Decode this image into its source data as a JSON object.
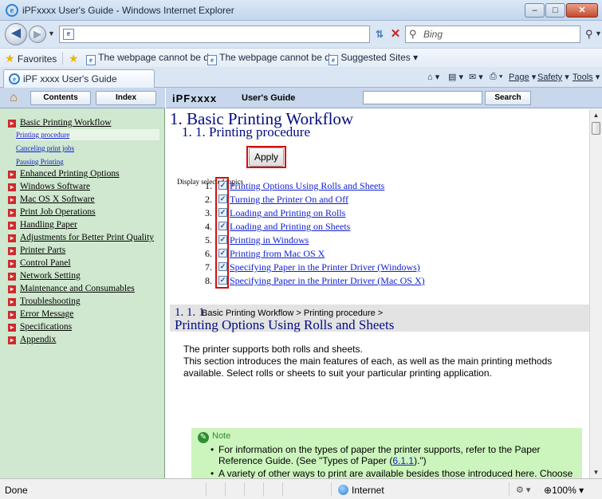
{
  "window": {
    "title": "iPFxxxx User's Guide - Windows Internet Explorer",
    "minimize": "–",
    "maximize": "□",
    "close": "✕"
  },
  "address": {
    "url": "",
    "search_placeholder": "Bing"
  },
  "favorites_bar": {
    "favorites_label": "Favorites",
    "links": [
      "The webpage cannot be d...",
      "The webpage cannot be d...",
      "Suggested Sites ▾"
    ]
  },
  "tab": {
    "title": "iPF xxxx User's Guide"
  },
  "command_bar": {
    "page": "Page",
    "safety": "Safety",
    "tools": "Tools"
  },
  "left_pane": {
    "tabs": {
      "contents": "Contents",
      "index": "Index"
    },
    "tree": [
      {
        "label": "Basic Printing Workflow",
        "children": [
          "Printing procedure",
          "Canceling print jobs",
          "Pausing Printing"
        ]
      },
      {
        "label": "Enhanced Printing Options"
      },
      {
        "label": "Windows Software"
      },
      {
        "label": "Mac OS X Software"
      },
      {
        "label": "Print Job Operations"
      },
      {
        "label": "Handling Paper"
      },
      {
        "label": "Adjustments for Better Print Quality"
      },
      {
        "label": "Printer Parts"
      },
      {
        "label": "Control Panel"
      },
      {
        "label": "Network Setting"
      },
      {
        "label": "Maintenance and Consumables"
      },
      {
        "label": "Troubleshooting"
      },
      {
        "label": "Error Message"
      },
      {
        "label": "Specifications"
      },
      {
        "label": "Appendix"
      }
    ]
  },
  "header": {
    "brand": "iPFxxxx",
    "title": "User's Guide",
    "search_button": "Search"
  },
  "main": {
    "h1": "1. Basic Printing Workflow",
    "h2": "1. 1. Printing procedure",
    "display_label": "Display selected topics",
    "apply_label": "Apply",
    "topics": [
      {
        "num": "1.",
        "label": "Printing Options Using Rolls and Sheets"
      },
      {
        "num": "2.",
        "label": "Turning the Printer On and Off"
      },
      {
        "num": "3.",
        "label": "Loading and Printing on Rolls"
      },
      {
        "num": "4.",
        "label": "Loading and Printing on Sheets"
      },
      {
        "num": "5.",
        "label": "Printing in Windows"
      },
      {
        "num": "6.",
        "label": "Printing from Mac OS X"
      },
      {
        "num": "7.",
        "label": "Specifying Paper in the Printer Driver (Windows)"
      },
      {
        "num": "8.",
        "label": "Specifying Paper in the Printer Driver (Mac OS X)"
      }
    ],
    "section": {
      "number": "1. 1. 1.",
      "breadcrumb": "Basic Printing Workflow > Printing procedure >",
      "title": "Printing Options Using Rolls and Sheets",
      "para1": "The printer supports both rolls and sheets.",
      "para2": "This section introduces the main features of each, as well as the main printing methods available. Select rolls or sheets to suit your particular printing application."
    },
    "note": {
      "label": "Note",
      "item1_text": "For information on the types of paper the printer supports, refer to the Paper Reference Guide.  (See \"Types of Paper (",
      "item1_link": "6.1.1",
      "item1_tail": ").\")",
      "item2": "A variety of other ways to print are available besides those introduced here. Choose the printing method that suits your particular printing application, referring to \"Working With Various Print Jobs\" and \"Enhanced Printing Options\" from the table of contents."
    }
  },
  "status": {
    "text": "Done",
    "zone": "Internet",
    "zoom": "100%"
  }
}
